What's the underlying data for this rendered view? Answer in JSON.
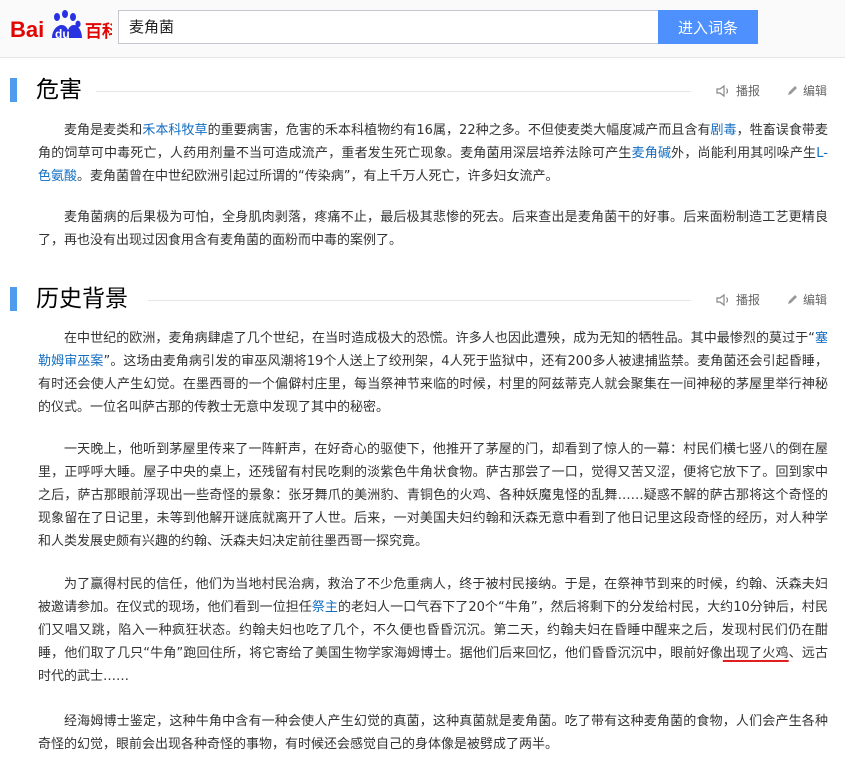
{
  "header": {
    "logo_text_bai": "Bai",
    "logo_text_du": "du",
    "logo_text_baike": "百科",
    "search_value": "麦角菌",
    "search_button": "进入词条"
  },
  "sections": [
    {
      "title": "危害",
      "report_label": "播报",
      "edit_label": "编辑"
    },
    {
      "title": "历史背景",
      "report_label": "播报",
      "edit_label": "编辑"
    }
  ],
  "p1": {
    "t1": "麦角是麦类和",
    "l1": "禾本科牧草",
    "t2": "的重要病害，危害的禾本科植物约有16属，22种之多。不但使麦类大幅度减产而且含有",
    "l2": "剧毒",
    "t3": "，牲畜误食带麦角的饲草可中毒死亡，人药用剂量不当可造成流产，重者发生死亡现象。麦角菌用深层培养法除可产生",
    "l3": "麦角碱",
    "t4": "外，尚能利用其吲哚产生",
    "l4": "L-色氨酸",
    "t5": "。麦角菌曾在中世纪欧洲引起过所谓的“传染病”，有上千万人死亡，许多妇女流产。"
  },
  "p2": "麦角菌病的后果极为可怕，全身肌肉剥落，疼痛不止，最后极其悲惨的死去。后来查出是麦角菌干的好事。后来面粉制造工艺更精良了，再也没有出现过因食用含有麦角菌的面粉而中毒的案例了。",
  "p3": {
    "t1": "在中世纪的欧洲，麦角病肆虐了几个世纪，在当时造成极大的恐慌。许多人也因此遭殃，成为无知的牺牲品。其中最惨烈的莫过于“",
    "l1": "塞勒姆审巫案",
    "t2": "”。这场由麦角病引发的审巫风潮将19个人送上了绞刑架，4人死于监狱中，还有200多人被逮捕监禁。麦角菌还会引起昏睡，有时还会使人产生幻觉。在墨西哥的一个偏僻村庄里，每当祭神节来临的时候，村里的阿兹蒂克人就会聚集在一间神秘的茅屋里举行神秘的仪式。一位名叫萨古那的传教士无意中发现了其中的秘密。"
  },
  "p4": "一天晚上，他听到茅屋里传来了一阵鼾声，在好奇心的驱使下，他推开了茅屋的门，却看到了惊人的一幕：村民们横七竖八的倒在屋里，正呼呼大睡。屋子中央的桌上，还残留有村民吃剩的淡紫色牛角状食物。萨古那尝了一口，觉得又苦又涩，便将它放下了。回到家中之后，萨古那眼前浮现出一些奇怪的景象：张牙舞爪的美洲豹、青铜色的火鸡、各种妖魔鬼怪的乱舞……疑惑不解的萨古那将这个奇怪的现象留在了日记里，未等到他解开谜底就离开了人世。后来，一对美国夫妇约翰和沃森无意中看到了他日记里这段奇怪的经历，对人种学和人类发展史颇有兴趣的约翰、沃森夫妇决定前往墨西哥一探究竟。",
  "p5": {
    "t1": "为了赢得村民的信任，他们为当地村民治病，救治了不少危重病人，终于被村民接纳。于是，在祭神节到来的时候，约翰、沃森夫妇被邀请参加。在仪式的现场，他们看到一位担任",
    "l1": "祭主",
    "t2": "的老妇人一口气吞下了20个“牛角”，然后将剩下的分发给村民，大约10分钟后，村民们又唱又跳，陷入一种疯狂状态。约翰夫妇也吃了几个，不久便也昏昏沉沉。第二天，约翰夫妇在昏睡中醒来之后，发现村民们仍在酣睡，他们取了几只“牛角”跑回住所，将它寄给了美国生物学家海姆博士。据他们后来回忆，他们昏昏沉沉中，眼前好像",
    "u1": "出现了火鸡",
    "t3": "、远古时代的武士……"
  },
  "p6": "经海姆博士鉴定，这种牛角中含有一种会使人产生幻觉的真菌，这种真菌就是麦角菌。吃了带有这种麦角菌的食物，人们会产生各种奇怪的幻觉，眼前会出现各种奇怪的事物，有时候还会感觉自己的身体像是被劈成了两半。"
}
